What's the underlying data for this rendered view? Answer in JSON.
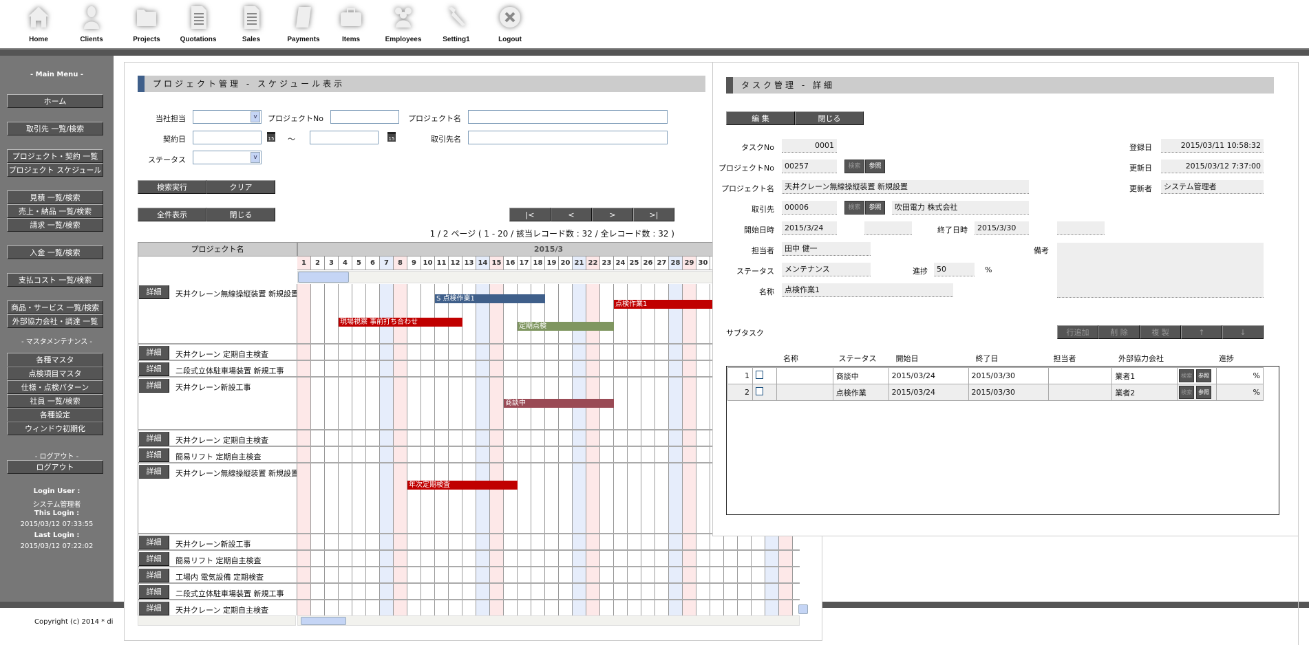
{
  "nav": [
    {
      "label": "Home",
      "icon": "home-icon"
    },
    {
      "label": "Clients",
      "icon": "person-icon"
    },
    {
      "label": "Projects",
      "icon": "folder-icon"
    },
    {
      "label": "Quotations",
      "icon": "document-icon"
    },
    {
      "label": "Sales",
      "icon": "document-icon"
    },
    {
      "label": "Payments",
      "icon": "scroll-icon"
    },
    {
      "label": "Items",
      "icon": "toolbox-icon"
    },
    {
      "label": "Employees",
      "icon": "group-icon"
    },
    {
      "label": "Setting1",
      "icon": "wrench-icon"
    },
    {
      "label": "Logout",
      "icon": "close-circle-icon"
    }
  ],
  "sidebar": {
    "main_heading": "- Main Menu -",
    "items": [
      "ホーム",
      "取引先 一覧/検索",
      "プロジェクト・契約 一覧",
      "プロジェクト スケジュール",
      "見積 一覧/検索",
      "売上・納品 一覧/検索",
      "請求 一覧/検索",
      "入金 一覧/検索",
      "支払コスト 一覧/検索",
      "商品・サービス 一覧/検索",
      "外部協力会社・調達 一覧"
    ],
    "master_heading": "- マスタメンテナンス -",
    "master_items": [
      "各種マスタ",
      "点検項目マスタ",
      "仕様・点検パターン",
      "社員 一覧/検索",
      "各種設定",
      "ウィンドウ初期化"
    ],
    "logout_heading": "- ログアウト -",
    "logout_label": "ログアウト",
    "login_user_label": "Login User :",
    "login_user": "システム管理者",
    "this_login_label": "This Login :",
    "this_login": "2015/03/12 07:33:55",
    "last_login_label": "Last Login :",
    "last_login": "2015/03/12 07:22:02"
  },
  "footer": {
    "copyright": "Copyright (c) 2014 * di"
  },
  "schedule": {
    "title": "プロジェクト管理 - スケジュール表示",
    "filters": {
      "staff_label": "当社担当",
      "project_no_label": "プロジェクトNo",
      "project_name_label": "プロジェクト名",
      "contract_date_label": "契約日",
      "tilde": "～",
      "client_name_label": "取引先名",
      "status_label": "ステータス",
      "calendar_glyph": "15"
    },
    "buttons": {
      "search": "検索実行",
      "clear": "クリア",
      "show_all": "全件表示",
      "close": "閉じる"
    },
    "pager": {
      "first": "|<",
      "prev": "<",
      "next": ">",
      "last": ">|",
      "info": "1 / 2 ページ ( 1 - 20 / 該当レコード数 : 32 / 全レコード数 : 32 )"
    },
    "gantt": {
      "name_header": "プロジェクト名",
      "month": "2015/3",
      "days": [
        "1",
        "2",
        "3",
        "4",
        "5",
        "6",
        "7",
        "8",
        "9",
        "10",
        "11",
        "12",
        "13",
        "14",
        "15",
        "16",
        "17",
        "18",
        "19",
        "20",
        "21",
        "22",
        "23",
        "24",
        "25",
        "26",
        "27",
        "28",
        "29",
        "30"
      ],
      "detail_label": "詳細",
      "rows": [
        {
          "name": "天井クレーン無線操縦装置 新規設置",
          "tasks": [
            {
              "label": "S 点検作業1",
              "start": 11,
              "end": 18,
              "color": "#3f5f8a"
            },
            {
              "label": "点検作業1",
              "start": 24,
              "end": 31,
              "color": "#c00000"
            },
            {
              "label": "現場視察 事前打ち合わせ",
              "start": 4,
              "end": 12,
              "color": "#c00000"
            },
            {
              "label": "定期点検",
              "start": 17,
              "end": 23,
              "color": "#7f9660"
            }
          ]
        },
        {
          "name": "天井クレーン 定期自主検査",
          "tasks": []
        },
        {
          "name": "二段式立体駐車場装置 新規工事",
          "tasks": []
        },
        {
          "name": "天井クレーン新設工事",
          "tasks": [
            {
              "label": "商談中",
              "start": 16,
              "end": 23,
              "color": "#9a4a55"
            }
          ]
        },
        {
          "name": "天井クレーン 定期自主検査",
          "tasks": []
        },
        {
          "name": "簡易リフト 定期自主検査",
          "tasks": []
        },
        {
          "name": "天井クレーン無線操縦装置 新規設置",
          "tasks": [
            {
              "label": "年次定期検査",
              "start": 9,
              "end": 16,
              "color": "#c00000"
            }
          ]
        },
        {
          "name": "天井クレーン新設工事",
          "tasks": []
        },
        {
          "name": "簡易リフト 定期自主検査",
          "tasks": []
        },
        {
          "name": "工場内 電気設備 定期検査",
          "tasks": []
        },
        {
          "name": "二段式立体駐車場装置 新規工事",
          "tasks": []
        },
        {
          "name": "天井クレーン 定期自主検査",
          "tasks": []
        }
      ]
    }
  },
  "task": {
    "title": "タスク管理 - 詳細",
    "buttons": {
      "edit": "編 集",
      "close": "閉じる",
      "search": "検索",
      "ref": "参照"
    },
    "fields": {
      "task_no_label": "タスクNo",
      "task_no": "0001",
      "project_no_label": "プロジェクトNo",
      "project_no": "00257",
      "project_name_label": "プロジェクト名",
      "project_name": "天井クレーン無線操縦装置 新規設置",
      "client_label": "取引先",
      "client_code": "00006",
      "client_name": "吹田電力 株式会社",
      "start_label": "開始日時",
      "start_date": "2015/3/24",
      "start_time": "",
      "end_label": "終了日時",
      "end_date": "2015/3/30",
      "end_time": "",
      "staff_label": "担当者",
      "staff": "田中 健一",
      "status_label": "ステータス",
      "status": "メンテナンス",
      "progress_label": "進捗",
      "progress": "50",
      "percent": "%",
      "name_label": "名称",
      "name": "点検作業1",
      "note_label": "備考",
      "note": "",
      "registered_label": "登録日",
      "registered": "2015/03/11 10:58:32",
      "updated_label": "更新日",
      "updated": "2015/03/12 7:37:00",
      "updater_label": "更新者",
      "updater": "システム管理者"
    },
    "subtask": {
      "label": "サブタスク",
      "buttons": [
        "行追加",
        "削 除",
        "複 製",
        "↑",
        "↓"
      ],
      "headers": [
        "名称",
        "ステータス",
        "開始日",
        "終了日",
        "担当者",
        "外部協力会社",
        "進捗"
      ],
      "rows": [
        {
          "no": "1",
          "checked": false,
          "name": "",
          "status": "商談中",
          "start": "2015/03/24",
          "end": "2015/03/30",
          "staff": "",
          "vendor": "業者1",
          "progress": "",
          "percent": "%"
        },
        {
          "no": "2",
          "checked": false,
          "name": "",
          "status": "点検作業",
          "start": "2015/03/24",
          "end": "2015/03/30",
          "staff": "",
          "vendor": "業者2",
          "progress": "",
          "percent": "%"
        }
      ]
    }
  }
}
